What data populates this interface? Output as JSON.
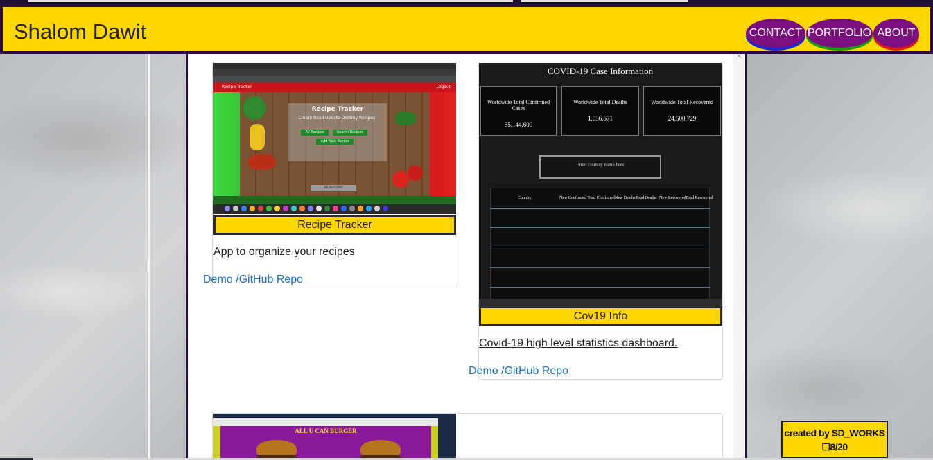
{
  "header": {
    "brand": "Shalom Dawit",
    "nav": [
      {
        "label": "CONTACT"
      },
      {
        "label": "PORTFOLIO"
      },
      {
        "label": "ABOUT"
      }
    ]
  },
  "projects": [
    {
      "title": "Recipe Tracker",
      "description": "App to organize your recipes",
      "link": "Demo /GitHub Repo",
      "screenshot": {
        "nav_brand": "Recipe Tracker",
        "nav_logout": "Logout",
        "heading": "Recipe Tracker",
        "subheading": "Create Read Update Destroy Recipes!",
        "buttons": [
          "All Recipes",
          "Search Recipes",
          "Add New Recipe"
        ],
        "footer_button": "All Recipes"
      }
    },
    {
      "title": "Cov19 Info",
      "description": "Covid-19 high level statistics dashboard.",
      "link": "Demo /GitHub Repo",
      "screenshot": {
        "heading": "COVID-19 Case Information",
        "stats": [
          {
            "label": "Worldwide Total Confirmed Cases",
            "value": "35,144,600"
          },
          {
            "label": "Worldwide Total Deaths",
            "value": "1,036,571"
          },
          {
            "label": "Worldwide Total Recovered",
            "value": "24,500,729"
          }
        ],
        "search_placeholder": "Enter country name here",
        "columns": [
          "Country",
          "New Confirmed",
          "Total Confirmed",
          "New Deaths",
          "Total Deaths",
          "New Recovered",
          "Total Recovered"
        ]
      }
    },
    {
      "screenshot": {
        "heading": "ALL U CAN BURGER"
      }
    }
  ],
  "credit": {
    "line1": "created by SD_WORKS",
    "line2": "8/20"
  }
}
